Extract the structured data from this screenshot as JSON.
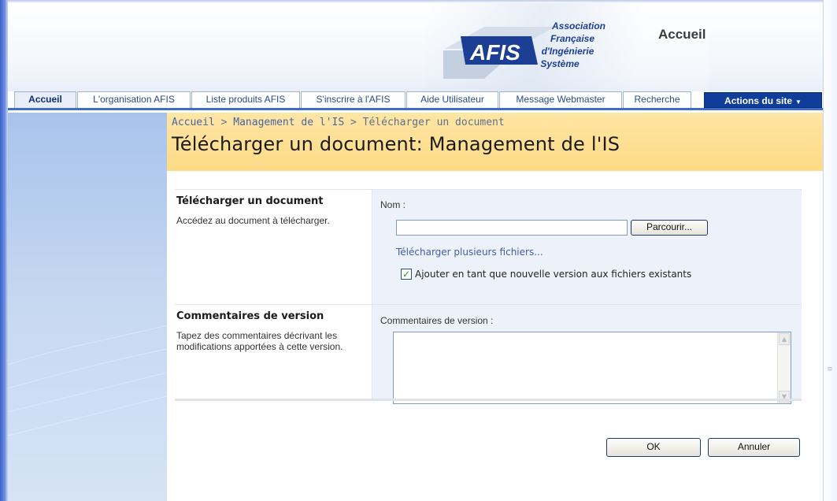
{
  "header": {
    "title": "Accueil",
    "logo": {
      "abbr": "AFIS",
      "line1": "Association",
      "line2": "Française",
      "line3": "d'Ingénierie",
      "line4": "Système"
    }
  },
  "nav": {
    "tabs": [
      {
        "label": "Accueil",
        "active": true
      },
      {
        "label": "L'organisation AFIS",
        "active": false
      },
      {
        "label": "Liste produits AFIS",
        "active": false
      },
      {
        "label": "S'inscrire à l'AFIS",
        "active": false
      },
      {
        "label": "Aide Utilisateur",
        "active": false
      },
      {
        "label": "Message Webmaster",
        "active": false
      },
      {
        "label": "Recherche",
        "active": false
      }
    ],
    "actions_label": "Actions du site"
  },
  "breadcrumb": {
    "items": [
      "Accueil",
      "Management de l'IS",
      "Télécharger un document"
    ],
    "separator": ">"
  },
  "page": {
    "title": "Télécharger un document: Management de l'IS"
  },
  "upload_section": {
    "title": "Télécharger un document",
    "description": "Accédez au document à télécharger.",
    "field_label": "Nom :",
    "file_value": "",
    "browse_label": "Parcourir...",
    "multi_link": "Télécharger plusieurs fichiers...",
    "checkbox_checked": true,
    "checkbox_label": "Ajouter en tant que nouvelle version aux fichiers existants"
  },
  "comments_section": {
    "title": "Commentaires de version",
    "description": "Tapez des commentaires décrivant les modifications apportées à cette version.",
    "field_label": "Commentaires de version :",
    "value": ""
  },
  "buttons": {
    "ok_label": "OK",
    "cancel_label": "Annuler"
  },
  "colors": {
    "tab_accent": "#3f6ec4",
    "actions_bg": "#0f3d99",
    "title_band": "#fdda85",
    "left_nav": "#c7d8f1",
    "field_bg": "#edf2fa",
    "link": "#3f5ea8"
  },
  "icons": {
    "checkbox": "check-icon",
    "actions_caret": "caret-down-icon"
  }
}
